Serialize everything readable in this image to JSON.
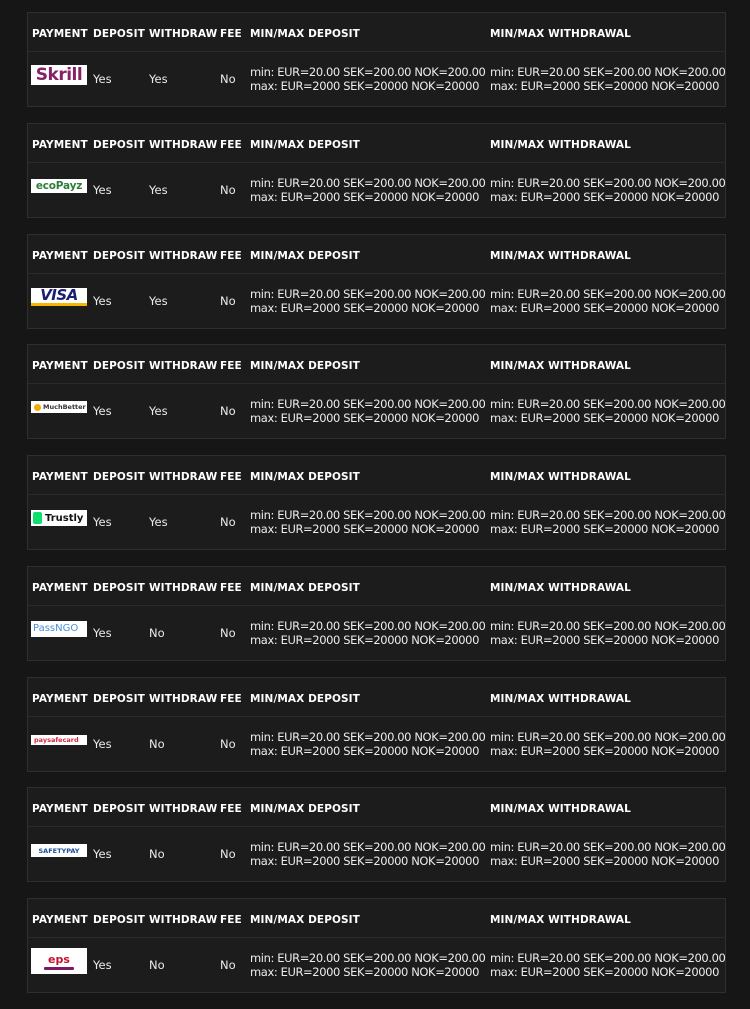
{
  "headers": {
    "payment": "PAYMENT",
    "deposit": "DEPOSIT",
    "withdraw": "WITHDRAW",
    "fee": "FEE",
    "minmax_deposit": "MIN/MAX DEPOSIT",
    "minmax_withdrawal": "MIN/MAX WITHDRAWAL"
  },
  "methods": [
    {
      "logo": "Skrill",
      "logo_icon": "skrill-logo",
      "deposit": "Yes",
      "withdraw": "Yes",
      "fee": "No",
      "dep_min": "min: EUR=20.00 SEK=200.00 NOK=200.00",
      "dep_max": "max: EUR=2000 SEK=20000 NOK=20000",
      "wd_min": "min: EUR=20.00 SEK=200.00 NOK=200.00",
      "wd_max": "max: EUR=2000 SEK=20000 NOK=20000"
    },
    {
      "logo": "ecoPayz",
      "logo_icon": "ecopayz-logo",
      "deposit": "Yes",
      "withdraw": "Yes",
      "fee": "No",
      "dep_min": "min: EUR=20.00 SEK=200.00 NOK=200.00",
      "dep_max": "max: EUR=2000 SEK=20000 NOK=20000",
      "wd_min": "min: EUR=20.00 SEK=200.00 NOK=200.00",
      "wd_max": "max: EUR=2000 SEK=20000 NOK=20000"
    },
    {
      "logo": "VISA",
      "logo_icon": "visa-logo",
      "deposit": "Yes",
      "withdraw": "Yes",
      "fee": "No",
      "dep_min": "min: EUR=20.00 SEK=200.00 NOK=200.00",
      "dep_max": "max: EUR=2000 SEK=20000 NOK=20000",
      "wd_min": "min: EUR=20.00 SEK=200.00 NOK=200.00",
      "wd_max": "max: EUR=2000 SEK=20000 NOK=20000"
    },
    {
      "logo": "MuchBetter",
      "logo_icon": "muchbetter-logo",
      "deposit": "Yes",
      "withdraw": "Yes",
      "fee": "No",
      "dep_min": "min: EUR=20.00 SEK=200.00 NOK=200.00",
      "dep_max": "max: EUR=2000 SEK=20000 NOK=20000",
      "wd_min": "min: EUR=20.00 SEK=200.00 NOK=200.00",
      "wd_max": "max: EUR=2000 SEK=20000 NOK=20000"
    },
    {
      "logo": "Trustly",
      "logo_icon": "trustly-logo",
      "deposit": "Yes",
      "withdraw": "Yes",
      "fee": "No",
      "dep_min": "min: EUR=20.00 SEK=200.00 NOK=200.00",
      "dep_max": "max: EUR=2000 SEK=20000 NOK=20000",
      "wd_min": "min: EUR=20.00 SEK=200.00 NOK=200.00",
      "wd_max": "max: EUR=2000 SEK=20000 NOK=20000"
    },
    {
      "logo": "PassNGO",
      "logo_icon": "passngo-logo",
      "deposit": "Yes",
      "withdraw": "No",
      "fee": "No",
      "dep_min": "min: EUR=20.00 SEK=200.00 NOK=200.00",
      "dep_max": "max: EUR=2000 SEK=20000 NOK=20000",
      "wd_min": "min: EUR=20.00 SEK=200.00 NOK=200.00",
      "wd_max": "max: EUR=2000 SEK=20000 NOK=20000"
    },
    {
      "logo": "paysafecard",
      "logo_icon": "paysafecard-logo",
      "deposit": "Yes",
      "withdraw": "No",
      "fee": "No",
      "dep_min": "min: EUR=20.00 SEK=200.00 NOK=200.00",
      "dep_max": "max: EUR=2000 SEK=20000 NOK=20000",
      "wd_min": "min: EUR=20.00 SEK=200.00 NOK=200.00",
      "wd_max": "max: EUR=2000 SEK=20000 NOK=20000"
    },
    {
      "logo": "SAFETYPAY",
      "logo_icon": "safetypay-logo",
      "deposit": "Yes",
      "withdraw": "No",
      "fee": "No",
      "dep_min": "min: EUR=20.00 SEK=200.00 NOK=200.00",
      "dep_max": "max: EUR=2000 SEK=20000 NOK=20000",
      "wd_min": "min: EUR=20.00 SEK=200.00 NOK=200.00",
      "wd_max": "max: EUR=2000 SEK=20000 NOK=20000"
    },
    {
      "logo": "eps",
      "logo_icon": "eps-logo",
      "deposit": "Yes",
      "withdraw": "No",
      "fee": "No",
      "dep_min": "min: EUR=20.00 SEK=200.00 NOK=200.00",
      "dep_max": "max: EUR=2000 SEK=20000 NOK=20000",
      "wd_min": "min: EUR=20.00 SEK=200.00 NOK=200.00",
      "wd_max": "max: EUR=2000 SEK=20000 NOK=20000"
    }
  ],
  "colors": {
    "page_bg": "#161616",
    "card_bg": "#1c1c1c",
    "text": "#ffffff"
  }
}
